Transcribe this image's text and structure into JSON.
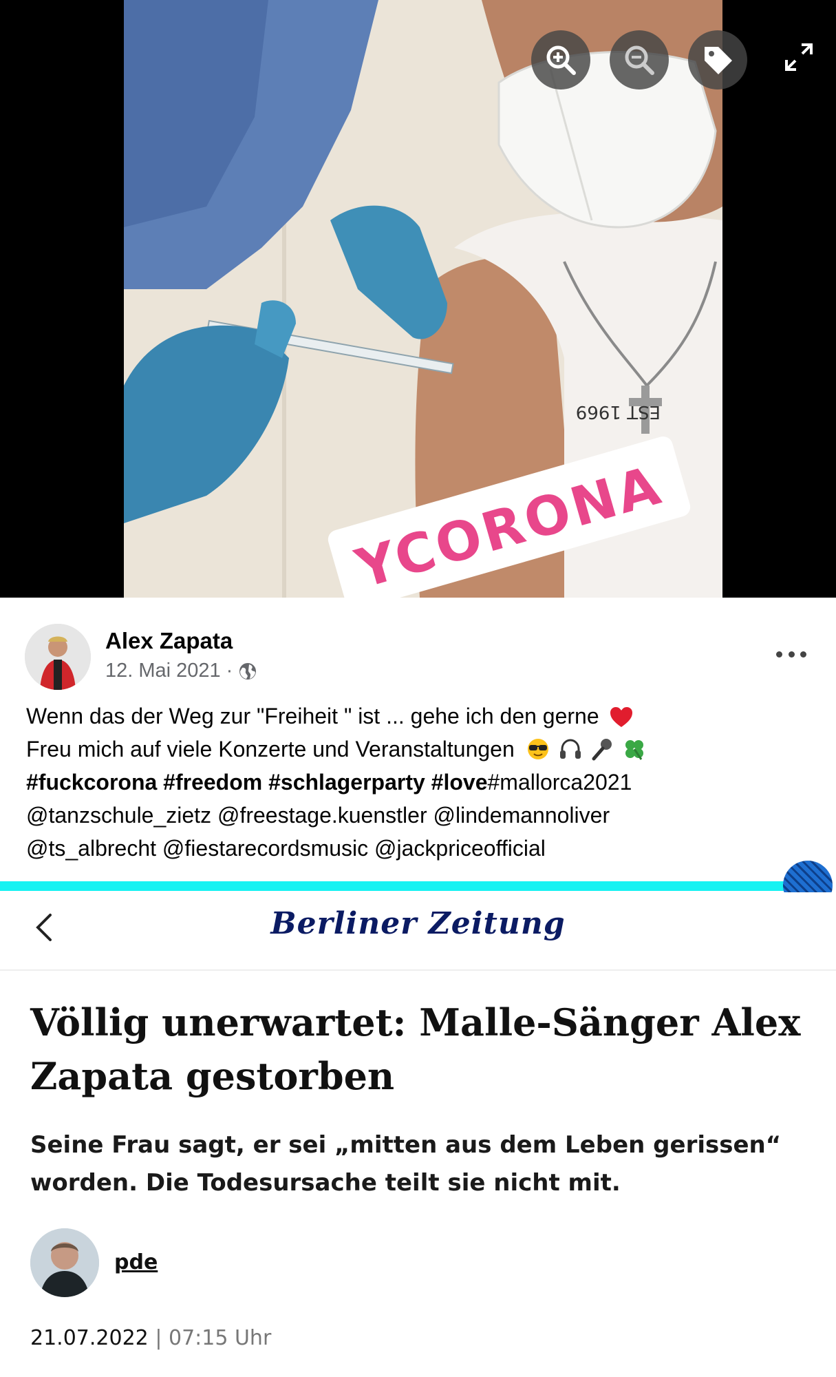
{
  "photo_viewer": {
    "sticker_text": "YCORONA",
    "shirt_text": "EST 1969",
    "controls": {
      "zoom_in": "zoom-in-icon",
      "zoom_out": "zoom-out-icon",
      "tag": "tag-icon",
      "fullscreen": "expand-icon"
    }
  },
  "post": {
    "author": "Alex Zapata",
    "date": "12. Mai 2021",
    "meta_separator": "·",
    "audience_icon": "globe-icon",
    "lines": {
      "line1": "Wenn das der Weg zur \"Freiheit \" ist ... gehe ich den gerne",
      "line2": "Freu mich auf viele Konzerte und Veranstaltungen",
      "line3_bold": "#fuckcorona #freedom #schlagerparty #love",
      "line3_rest": "#mallorca2021",
      "line4": "@tanzschule_zietz @freestage.kuenstler @lindemannoliver",
      "line5": "@ts_albrecht @fiestarecordsmusic @jackpriceofficial"
    },
    "emojis": [
      "heart-emoji",
      "sunglasses-emoji",
      "headphones-emoji",
      "microphone-emoji",
      "clover-emoji"
    ]
  },
  "article": {
    "masthead": "Berliner Zeitung",
    "headline": "Völlig unerwartet: Malle-Sänger Alex Zapata gestorben",
    "subline": "Seine Frau sagt, er sei „mitten aus dem Leben gerissen“ worden. Die Todesursache teilt sie nicht mit.",
    "author": "pde",
    "date": "21.07.2022",
    "separator": "|",
    "time": "07:15 Uhr"
  },
  "colors": {
    "divider": "#17f2f2",
    "masthead": "#0b1b63",
    "meta_gray": "#65676b",
    "sticker_pink": "#e8478b"
  }
}
